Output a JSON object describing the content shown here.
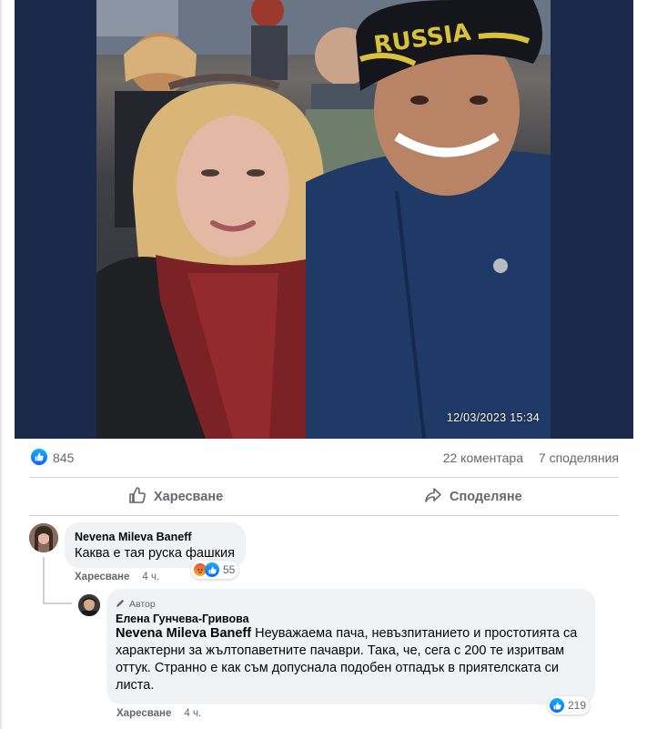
{
  "post": {
    "photo_timestamp": "12/03/2023 15:34",
    "cap_text": "RUSSIA",
    "reaction_count": "845",
    "comments": "22 коментара",
    "shares": "7 споделяния"
  },
  "actions": {
    "like_label": "Харесване",
    "share_label": "Споделяне"
  },
  "comment1": {
    "author": "Nevena Mileva Baneff",
    "text": "Каква е тая руска фашкия",
    "like_label": "Харесване",
    "time": "4 ч.",
    "reactions": "55"
  },
  "reply1": {
    "badge": "Автор",
    "author": "Елена Гунчева-Гривова",
    "mention": "Nevena Mileva Baneff",
    "text": " Неуважаема пача, невъзпитанието и простотията са характерни за жълтопаветните пачаври. Така, че, сега с 200 те изритвам оттук. Странно е как съм допуснала подобен отпадък в приятелската си листа.",
    "like_label": "Харесване",
    "time": "4 ч.",
    "reactions": "219"
  },
  "colors": {
    "accent": "#0866ff",
    "secondary_text": "#65676b",
    "bubble_bg": "#f0f2f5"
  }
}
